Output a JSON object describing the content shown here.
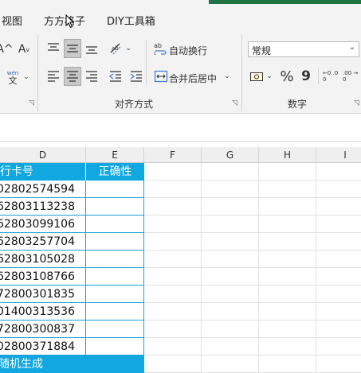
{
  "tabs": [
    {
      "label": "视图"
    },
    {
      "label": "方方格子"
    },
    {
      "label": "DIY工具箱"
    }
  ],
  "font_group": {
    "grow_label": "A^",
    "shrink_label": "A",
    "phonetic_label": "wén",
    "phonetic_char": "文"
  },
  "alignment": {
    "group_label": "对齐方式",
    "wrap_text_label": "自动换行",
    "merge_center_label": "合并后居中"
  },
  "number": {
    "group_label": "数字",
    "format_value": "常规",
    "percent_symbol": "%",
    "comma_symbol": "9",
    "increase_decimal": "←0 .00",
    "decrease_decimal": ".00 →0"
  },
  "columns": [
    "D",
    "E",
    "F",
    "G",
    "H",
    "I"
  ],
  "table": {
    "header_d": "行卡号",
    "header_e": "正确性",
    "rows": [
      "02802574594",
      "62803113238",
      "62803099106",
      "62803257704",
      "62803105028",
      "62803108766",
      "72800301835",
      "01400313536",
      "72800300837",
      "02800371884"
    ],
    "footer": "随机生成"
  },
  "colors": {
    "header_fill": "#11a7e0",
    "border": "#1aa0d6",
    "excel_green": "#217346"
  }
}
